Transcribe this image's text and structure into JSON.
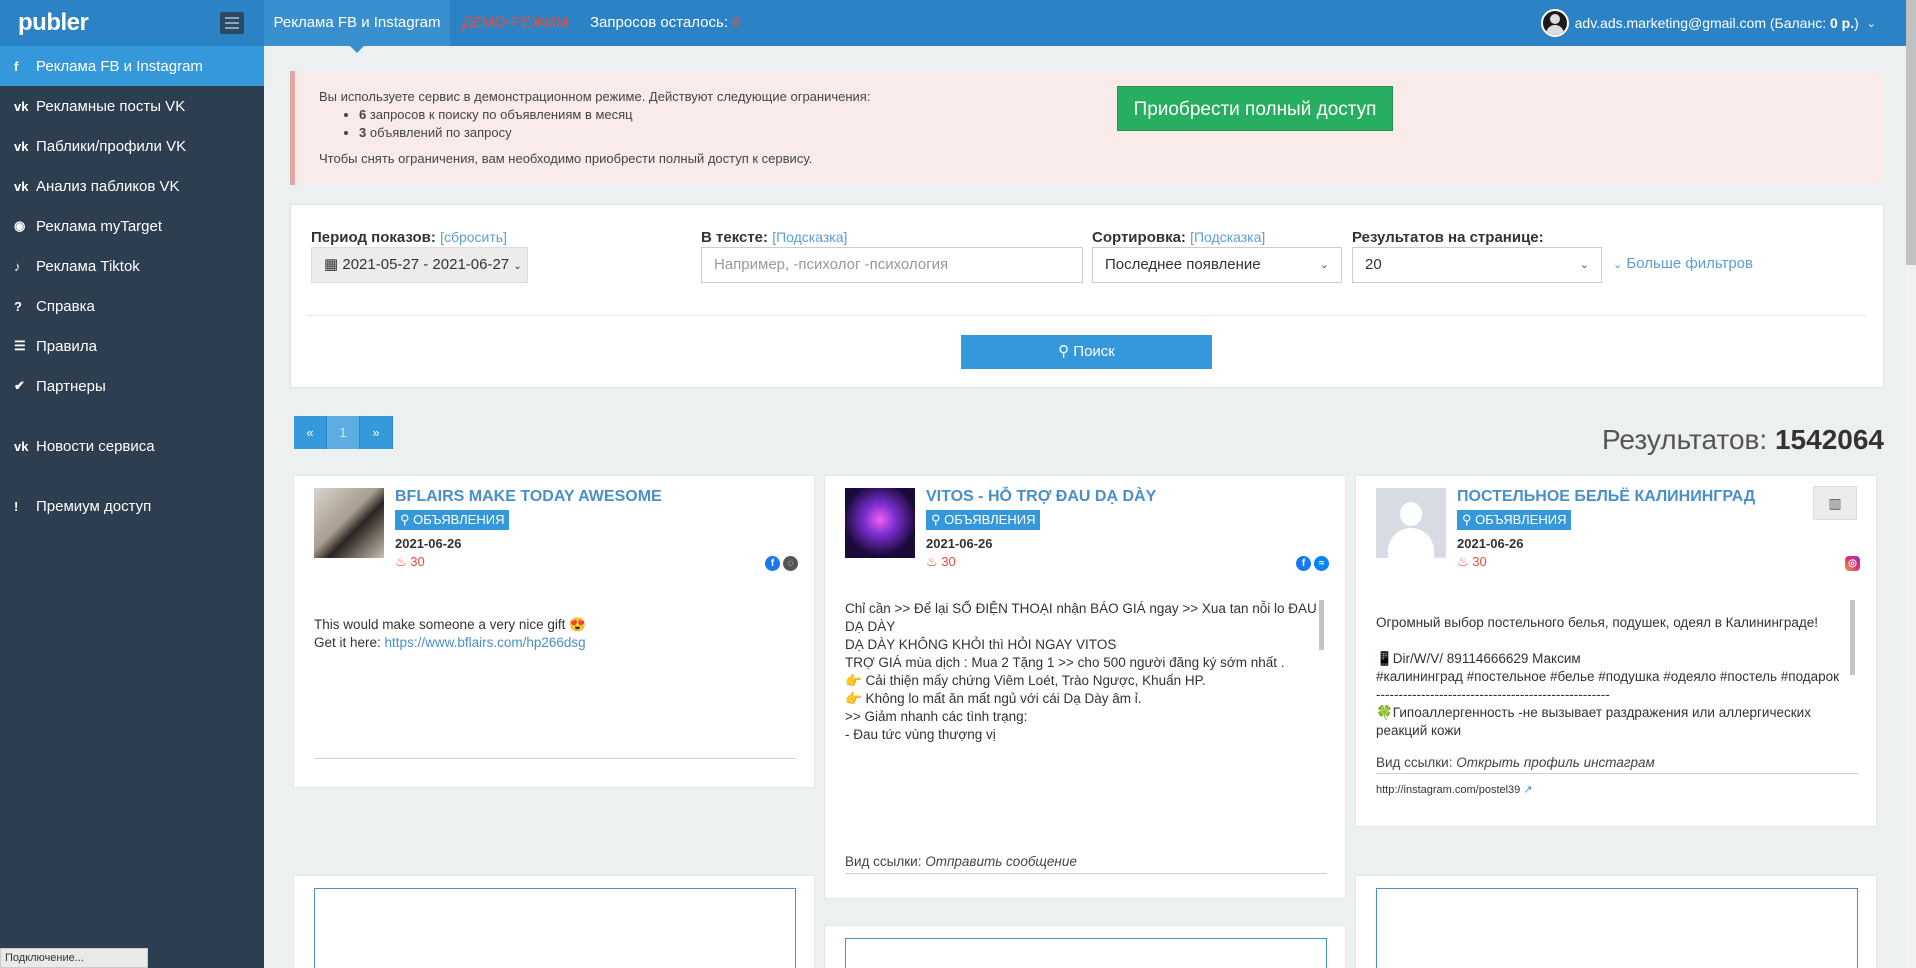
{
  "app": {
    "logo": "publer"
  },
  "topbar": {
    "active_tab": "Реклама FB и Instagram",
    "demo_label": "ДЕМО-РЕЖИМ",
    "requests_label": "Запросов осталось:",
    "requests_count": "6",
    "user_email": "adv.ads.marketing@gmail.com",
    "balance_label": "(Баланс:",
    "balance_value": "0 р.",
    "balance_close": ")"
  },
  "sidebar": {
    "items": [
      {
        "icon": "f",
        "label": "Реклама FB и Instagram"
      },
      {
        "icon": "vk",
        "label": "Рекламные посты VK"
      },
      {
        "icon": "vk",
        "label": "Паблики/профили VK"
      },
      {
        "icon": "vk",
        "label": "Анализ пабликов VK"
      },
      {
        "icon": "◉",
        "label": "Реклама myTarget"
      },
      {
        "icon": "♪",
        "label": "Реклама Tiktok"
      },
      {
        "icon": "?",
        "label": "Справка"
      },
      {
        "icon": "☰",
        "label": "Правила"
      },
      {
        "icon": "✔",
        "label": "Партнеры"
      },
      {
        "icon": "vk",
        "label": "Новости сервиса"
      },
      {
        "icon": "!",
        "label": "Премиум доступ"
      }
    ]
  },
  "alert": {
    "intro": "Вы используете сервис в демонстрационном режиме. Действуют следующие ограничения:",
    "limit1_num": "6",
    "limit1_text": " запросов к поиску по объявлениям в месяц",
    "limit2_num": "3",
    "limit2_text": " объявлений по запросу",
    "footer": "Чтобы снять ограничения, вам необходимо приобрести полный доступ к сервису.",
    "buy_button": "Приобрести полный доступ"
  },
  "filters": {
    "period_label": "Период показов:",
    "period_reset": "[сбросить]",
    "period_value": "2021-05-27 - 2021-06-27",
    "text_label": "В тексте:",
    "text_hint": "[Подсказка]",
    "text_placeholder": "Например, -психолог -психология",
    "sort_label": "Сортировка:",
    "sort_hint": "[Подсказка]",
    "sort_value": "Последнее появление",
    "per_page_label": "Результатов на странице:",
    "per_page_value": "20",
    "more_filters": "Больше фильтров",
    "search_button": "Поиск"
  },
  "pagination": {
    "prev": "«",
    "current": "1",
    "next": "»"
  },
  "results": {
    "label": "Результатов:",
    "count": "1542064"
  },
  "cards": [
    {
      "title": "BFLAIRS MAKE TODAY AWESOME",
      "badge": "ОБЪЯВЛЕНИЯ",
      "date": "2021-06-26",
      "likes": "30",
      "text1": "This would make someone a very nice gift 😍",
      "text2": "Get it here: ",
      "link": "https://www.bflairs.com/hp266dsg"
    },
    {
      "title": "VITOS - HỖ TRỢ ĐAU DẠ DÀY",
      "badge": "ОБЪЯВЛЕНИЯ",
      "date": "2021-06-26",
      "likes": "30",
      "lines": [
        "Chỉ cần >> Để lại SỐ ĐIỆN THOẠI nhận BÁO GIÁ ngay >> Xua tan nỗi lo ĐAU DẠ DÀY",
        "DẠ DÀY KHÔNG KHỎI thì HỎI NGAY VITOS",
        "TRỢ GIÁ mùa dịch : Mua 2 Tặng 1 >> cho 500 người đăng ký sớm nhất .",
        "👉 Cải thiện mấy chứng Viêm Loét, Trào Ngược, Khuẩn HP.",
        "👉 Không lo mất ăn mất ngủ với cái Dạ Dày âm ỉ.",
        ">> Giảm nhanh các tình trạng:",
        "- Đau tức vùng thượng vị"
      ],
      "link_type_label": "Вид ссылки:",
      "link_type_value": "Отправить сообщение"
    },
    {
      "title": "ПОСТЕЛЬНОЕ БЕЛЬЁ КАЛИНИНГРАД",
      "badge": "ОБЪЯВЛЕНИЯ",
      "date": "2021-06-26",
      "likes": "30",
      "lines": [
        "Огромный выбор постельного белья, подушек, одеял в Калининграде!",
        "",
        "📱Dir/W/V/ 89114666629 Максим",
        "#калининград #постельное #белье #подушка #одеяло #постель #подарок",
        "----------------------------------------------------",
        "🍀Гипоаллергенность -не вызывает раздражения или аллергических",
        "реакций кожи"
      ],
      "link_type_label": "Вид ссылки:",
      "link_type_value": "Открыть профиль инстаграм",
      "url": "http://instagram.com/postel39"
    }
  ],
  "status_bar": "Подключение..."
}
